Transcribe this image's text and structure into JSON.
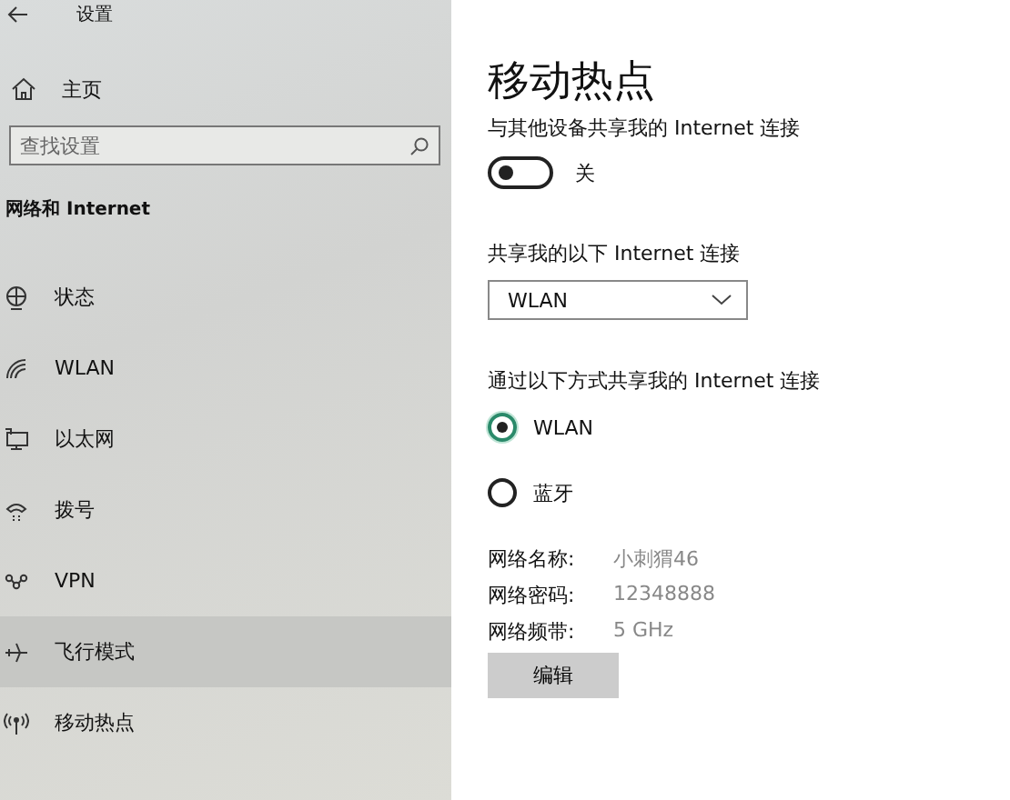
{
  "window": {
    "title": "设置"
  },
  "sidebar": {
    "home": "主页",
    "search": {
      "placeholder": "查找设置"
    },
    "section": "网络和 Internet",
    "items": [
      {
        "label": "状态",
        "kind": "status",
        "highlighted": false
      },
      {
        "label": "WLAN",
        "kind": "wlan",
        "highlighted": false
      },
      {
        "label": "以太网",
        "kind": "ethernet",
        "highlighted": false
      },
      {
        "label": "拨号",
        "kind": "dialup",
        "highlighted": false
      },
      {
        "label": "VPN",
        "kind": "vpn",
        "highlighted": false
      },
      {
        "label": "飞行模式",
        "kind": "airplane",
        "highlighted": true
      },
      {
        "label": "移动热点",
        "kind": "hotspot",
        "highlighted": false
      }
    ]
  },
  "content": {
    "title": "移动热点",
    "share_label": "与其他设备共享我的 Internet 连接",
    "toggle": {
      "on": false,
      "label": "关"
    },
    "source_label": "共享我的以下 Internet 连接",
    "source": {
      "value": "WLAN"
    },
    "method_label": "通过以下方式共享我的 Internet 连接",
    "methods": [
      {
        "label": "WLAN",
        "selected": true
      },
      {
        "label": "蓝牙",
        "selected": false
      }
    ],
    "info": [
      {
        "label": "网络名称:",
        "value": "小刺猬46"
      },
      {
        "label": "网络密码:",
        "value": "12348888"
      },
      {
        "label": "网络频带:",
        "value": "5 GHz"
      }
    ],
    "edit_button": "编辑"
  }
}
